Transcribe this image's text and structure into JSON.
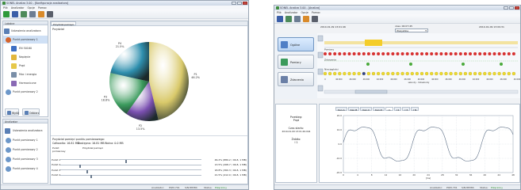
{
  "left_window": {
    "title": "SONEL Analiza 3.00 - [Konfiguracja analizatora]",
    "menu": [
      "Plik",
      "Analizator",
      "Opcje",
      "Pomoc"
    ],
    "left_panel_header": "Lokalne",
    "tree": [
      {
        "label": "Ustawienia analizatora",
        "icon": "analyzer-icon"
      },
      {
        "label": "Punkt pomiarowy 1",
        "icon": "measure-point-icon"
      },
      {
        "label": "EN 50160",
        "icon": "standard-icon"
      },
      {
        "label": "Napięcie",
        "icon": "voltage-icon"
      },
      {
        "label": "Prąd",
        "icon": "current-icon"
      },
      {
        "label": "Moc i energia",
        "icon": "power-icon"
      },
      {
        "label": "Harmoniczne",
        "icon": "harmonics-icon"
      },
      {
        "label": "Punkt pomiarowy 2",
        "icon": "measure-point-icon"
      }
    ],
    "bottom_buttons": [
      "Wyślij",
      "Odbierz"
    ],
    "analyzer_header": "Analizator",
    "analyzer_tree": [
      "Ustawienia analizatora",
      "Punkt pomiarowy 1",
      "Punkt pomiarowy 2",
      "Punkt pomiarowy 3",
      "Punkt pomiarowy 4"
    ],
    "tab_label": "Przydział pamięci",
    "chart_caption": "Przydział",
    "memory_info": "Przydział pamięci punktu pomiarowego:",
    "memory_sub": [
      "Całkowita: 16.81 MB",
      "Dostępna: 16.81 MB",
      "Wolna: 0.0 MB"
    ],
    "table_header": [
      "Punkt pomiarowy",
      "Przydział pamięci"
    ],
    "slider_rows": [
      {
        "label": "Punkt 1",
        "value": "46.2% (889.2 / 46.8, 1 MB)"
      },
      {
        "label": "Punkt 2",
        "value": "13.5% (268.7 / 46.8, 1 MB)"
      },
      {
        "label": "Punkt 3",
        "value": "18.8% (360.3 / 46.8, 1 MB)"
      },
      {
        "label": "Punkt 4",
        "value": "21.5% (412.0 / 46.8, 1 MB)"
      }
    ],
    "status": {
      "analyzer": "Analizator:",
      "pqm": "PQM-701",
      "sn": "S/N:88384",
      "status_label": "Status:",
      "status_value": "Połączony"
    }
  },
  "chart_data": {
    "type": "pie",
    "categories": [
      "P1",
      "P2",
      "P3",
      "P4"
    ],
    "values": [
      46.2,
      13.5,
      18.8,
      21.5
    ],
    "value_labels": [
      "46.2%",
      "13.5%",
      "18.8%",
      "21.5%"
    ],
    "colors": [
      "#d9c96a",
      "#7a4fb0",
      "#3a9a5c",
      "#2e8fae"
    ]
  },
  "right_window": {
    "title": "SONEL Analiza 3.00 - [Analiza]",
    "menu": [
      "Plik",
      "Analizator",
      "Opcje",
      "Pomoc"
    ],
    "date_start": "2010-01-09  13:01:46",
    "date_mid": "czas: 00:07:45",
    "combo": "Wszystkie",
    "date_end": "2010-01-09  13:09:31",
    "side_buttons": [
      {
        "label": "Ogólne",
        "icon": "general-icon",
        "active": true
      },
      {
        "label": "Pomiary",
        "icon": "measurements-icon",
        "active": false
      },
      {
        "label": "Zdarzenia",
        "icon": "events-icon",
        "active": false
      }
    ],
    "rows": [
      {
        "label": "Pomiary"
      },
      {
        "label": "Zdarzenia"
      },
      {
        "label": "Nieciągłości"
      }
    ],
    "axis_hint": "sekundy - milisekundy",
    "time_ticks": [
      "0",
      "46:000",
      "46:000",
      "46:000",
      "46:000",
      "46:000",
      "46:000",
      "46:000",
      "46:000",
      "46:000",
      "46:000",
      "46:000",
      "46:000",
      "46:000",
      "46:000"
    ],
    "info": [
      {
        "k": "Przebieg:",
        "v": "Prąd"
      },
      {
        "k": "Czas startu:",
        "v": "2010-01-09 13:01:46.044"
      },
      {
        "k": "Źródło:",
        "v": "I 1"
      }
    ],
    "tabs": [
      "Kan.A",
      "Kan.B",
      "Kan.C",
      "Kan.D",
      "I 1",
      "I 2",
      "I 3",
      "I N"
    ],
    "active_tab": 4,
    "plot_y_ticks": [
      "20.0",
      "10.0",
      "0.0",
      "-10.0",
      "-20.0"
    ],
    "plot_x_ticks": [
      "0",
      "4",
      "8",
      "12",
      "16",
      "20",
      "24",
      "28",
      "32",
      "36",
      "40",
      "44",
      "48"
    ],
    "plot_x_unit": "[ms]",
    "status": {
      "analyzer": "Analizator:",
      "pqm": "PQM-701",
      "sn": "S/N:88384",
      "status_label": "Status:",
      "status_value": "Połączony"
    }
  }
}
